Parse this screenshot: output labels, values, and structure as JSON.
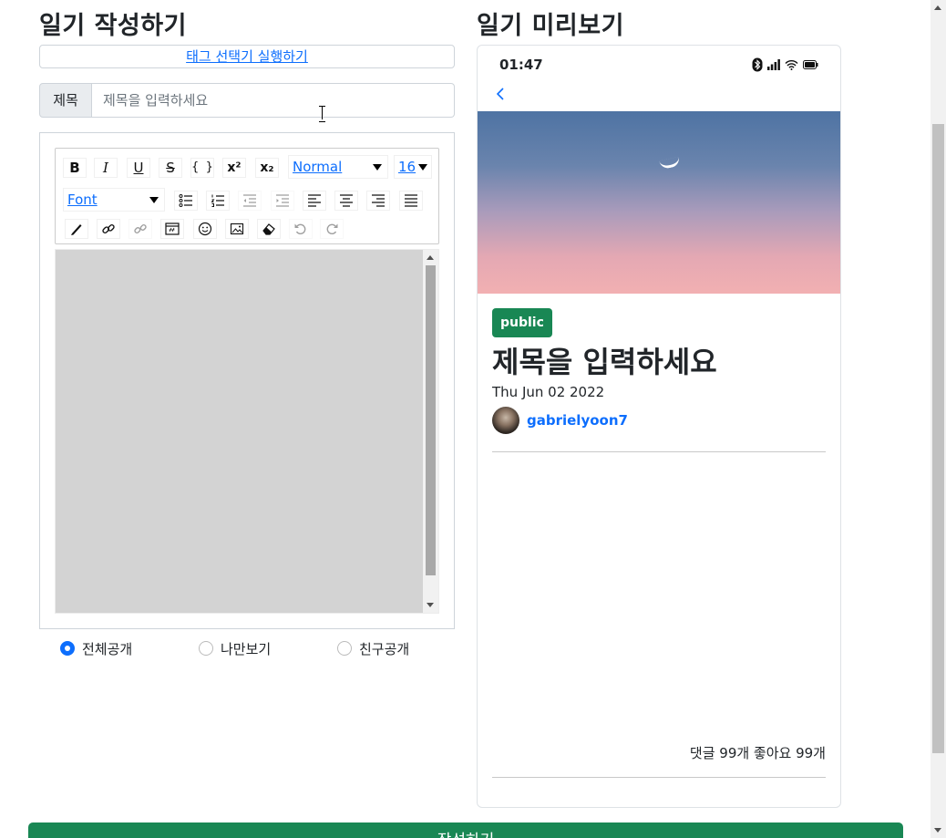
{
  "write_heading": "일기 작성하기",
  "preview_heading": "일기 미리보기",
  "tag_selector_link": "태그 선택기 실행하기",
  "title_field": {
    "label": "제목",
    "placeholder": "제목을 입력하세요",
    "value": ""
  },
  "toolbar": {
    "header_select": "Normal",
    "size_select": "16",
    "font_select": "Font",
    "bold": "B",
    "italic": "I",
    "underline": "U",
    "strike": "S",
    "code": "{ }",
    "superscript": "x²",
    "subscript": "x₂"
  },
  "visibility": {
    "selected": "전체공개",
    "options": [
      "전체공개",
      "나만보기",
      "친구공개"
    ]
  },
  "preview": {
    "status_time": "01:47",
    "badge": "public",
    "title": "제목을 입력하세요",
    "date": "Thu Jun 02 2022",
    "author": "gabrielyoon7",
    "stats": "댓글 99개 좋아요 99개"
  },
  "submit_label": "작성하기",
  "colors": {
    "primary": "#0d6efd",
    "success": "#198754"
  }
}
